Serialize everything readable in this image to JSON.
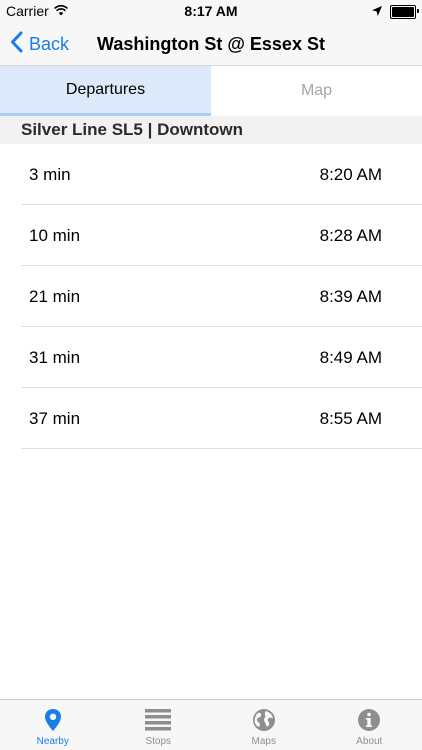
{
  "status": {
    "carrier": "Carrier",
    "time": "8:17 AM",
    "battery_level": 1.0
  },
  "nav": {
    "back_label": "Back",
    "title": "Washington St @ Essex St"
  },
  "tabs": [
    {
      "label": "Departures",
      "active": true
    },
    {
      "label": "Map",
      "active": false
    }
  ],
  "route": {
    "header": "Silver Line SL5 | Downtown"
  },
  "departures": [
    {
      "minutes": "3 min",
      "time": "8:20 AM"
    },
    {
      "minutes": "10 min",
      "time": "8:28 AM"
    },
    {
      "minutes": "21 min",
      "time": "8:39 AM"
    },
    {
      "minutes": "31 min",
      "time": "8:49 AM"
    },
    {
      "minutes": "37 min",
      "time": "8:55 AM"
    }
  ],
  "tab_bar": [
    {
      "label": "Nearby",
      "icon": "location-pin-icon",
      "active": true
    },
    {
      "label": "Stops",
      "icon": "list-icon",
      "active": false
    },
    {
      "label": "Maps",
      "icon": "globe-icon",
      "active": false
    },
    {
      "label": "About",
      "icon": "info-icon",
      "active": false
    }
  ],
  "colors": {
    "accent": "#1a7ee6",
    "active_tab_bg": "#dbe9fa",
    "inactive_icon": "#8e8e8e"
  }
}
